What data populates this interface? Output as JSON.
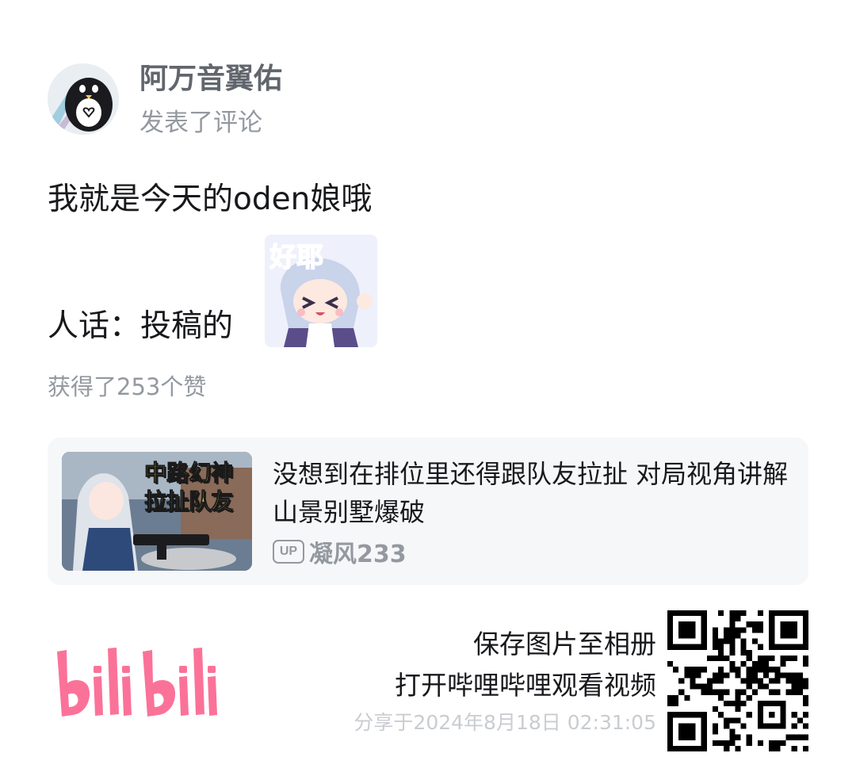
{
  "author": {
    "name": "阿万音翼佑",
    "action": "发表了评论"
  },
  "comment": {
    "line1": "我就是今天的oden娘哦",
    "line2": "人话：投稿的",
    "sticker_text": "好耶"
  },
  "likes_text": "获得了253个赞",
  "video": {
    "title": "没想到在排位里还得跟队友拉扯 对局视角讲解 山景别墅爆破",
    "thumb_caption_1": "中路幻神",
    "thumb_caption_2": "拉扯队友",
    "up_badge": "UP",
    "uploader": "凝风233"
  },
  "share": {
    "save_text": "保存图片至相册",
    "open_text": "打开哔哩哔哩观看视频",
    "time_text": "分享于2024年8月18日 02:31:05"
  },
  "colors": {
    "brand_pink": "#fb7299",
    "text_primary": "#18191c",
    "text_secondary": "#61666d",
    "text_tertiary": "#9499a0",
    "card_bg": "#f6f7f8"
  }
}
